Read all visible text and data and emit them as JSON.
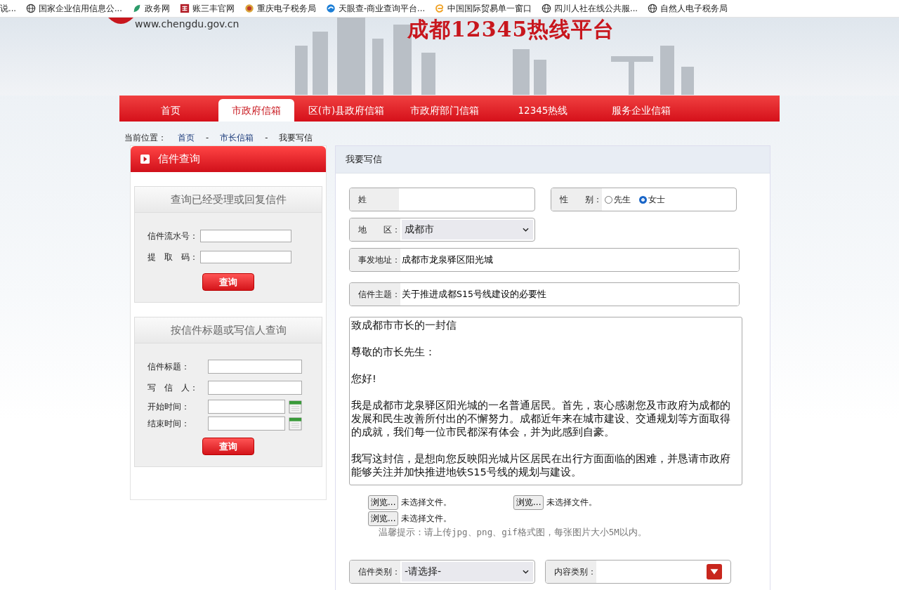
{
  "bookmarks": [
    {
      "label": "说...",
      "kind": "none"
    },
    {
      "label": "国家企业信用信息公...",
      "kind": "globe"
    },
    {
      "label": "政务网",
      "kind": "leaf"
    },
    {
      "label": "账三丰官网",
      "kind": "square"
    },
    {
      "label": "重庆电子税务局",
      "kind": "badge"
    },
    {
      "label": "天眼查-商业查询平台...",
      "kind": "swirl"
    },
    {
      "label": "中国国际贸易单一窗口",
      "kind": "e"
    },
    {
      "label": "四川人社在线公共服...",
      "kind": "globe"
    },
    {
      "label": "自然人电子税务局",
      "kind": "globe"
    }
  ],
  "header": {
    "url": "www.chengdu.gov.cn",
    "title": "成都12345热线平台"
  },
  "nav": [
    {
      "label": "首页",
      "selected": false
    },
    {
      "label": "市政府信箱",
      "selected": true
    },
    {
      "label": "区(市)县政府信箱",
      "selected": false
    },
    {
      "label": "市政府部门信箱",
      "selected": false
    },
    {
      "label": "12345热线",
      "selected": false
    },
    {
      "label": "服务企业信箱",
      "selected": false
    }
  ],
  "breadcrumb": {
    "label": "当前位置：",
    "links": [
      "首页",
      "市长信箱"
    ],
    "separator": "-",
    "current": "我要写信"
  },
  "query_panel": {
    "title": "信件查询",
    "sections": [
      {
        "title": "查询已经受理或回复信件",
        "fields": [
          {
            "label": "信件流水号：",
            "calendar": false
          },
          {
            "label": "提　取　码：",
            "calendar": false
          }
        ],
        "button": "查询"
      },
      {
        "title": "按信件标题或写信人查询",
        "fields": [
          {
            "label": "信件标题：",
            "calendar": false
          },
          {
            "label": "写　信　人：",
            "calendar": false
          },
          {
            "label": "开始时间：",
            "calendar": true
          },
          {
            "label": "结束时间：",
            "calendar": true
          }
        ],
        "button": "查询"
      }
    ]
  },
  "letter_form": {
    "title": "我要写信",
    "surname_label": "姓",
    "gender": {
      "label": "性　　别：",
      "options": [
        {
          "label": "先生",
          "selected": false
        },
        {
          "label": "女士",
          "selected": true
        }
      ]
    },
    "region": {
      "label": "地　　区：",
      "value": "成都市"
    },
    "address": {
      "label": "事发地址：",
      "value": "成都市龙泉驿区阳光城"
    },
    "subject": {
      "label": "信件主题：",
      "value": "关于推进成都S15号线建设的必要性"
    },
    "body": [
      "致成都市市长的一封信",
      "尊敬的市长先生：",
      "您好!",
      "我是成都市龙泉驿区阳光城的一名普通居民。首先，衷心感谢您及市政府为成都的发展和民生改善所付出的不懈努力。成都近年来在城市建设、交通规划等方面取得的成就，我们每一位市民都深有体会，并为此感到自豪。",
      "我写这封信，是想向您反映阳光城片区居民在出行方面面临的困难，并恳请市政府能够关注并加快推进地铁S15号线的规划与建设。"
    ],
    "uploads": [
      {
        "button": "浏览...",
        "status": "未选择文件。"
      },
      {
        "button": "浏览...",
        "status": "未选择文件。"
      },
      {
        "button": "浏览...",
        "status": "未选择文件。"
      }
    ],
    "upload_hint": "温馨提示：请上传jpg、png、gif格式图，每张图片大小5M以内。",
    "category": {
      "label": "信件类别：",
      "value": "-请选择-"
    },
    "content_type": {
      "label": "内容类别："
    }
  }
}
